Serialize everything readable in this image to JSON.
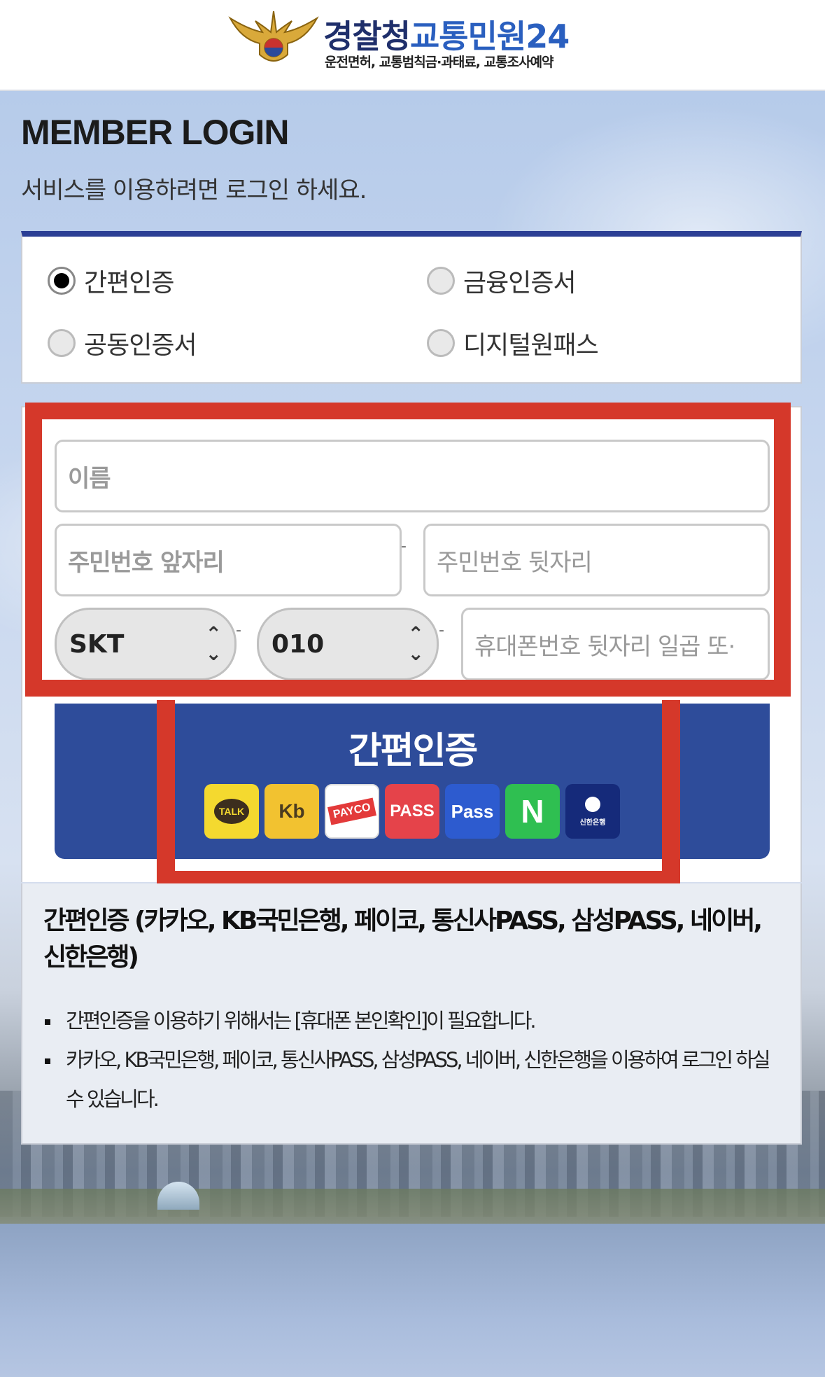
{
  "header": {
    "title_part1": "경찰청",
    "title_part2": "교통민원24",
    "subtitle": "운전면허, 교통범칙금·과태료, 교통조사예약"
  },
  "login": {
    "title": "MEMBER LOGIN",
    "subtitle": "서비스를 이용하려면 로그인 하세요."
  },
  "auth_options": [
    {
      "label": "간편인증",
      "selected": true
    },
    {
      "label": "금융인증서",
      "selected": false
    },
    {
      "label": "공동인증서",
      "selected": false
    },
    {
      "label": "디지털원패스",
      "selected": false
    }
  ],
  "form": {
    "name_placeholder": "이름",
    "rrn_front_placeholder": "주민번호 앞자리",
    "rrn_back_placeholder": "주민번호 뒷자리",
    "carrier_value": "SKT",
    "phone_prefix_value": "010",
    "phone_rest_placeholder": "휴대폰번호 뒷자리 일곱 또·",
    "separator": "-"
  },
  "auth_button": {
    "label": "간편인증",
    "providers": [
      {
        "name": "kakao-icon",
        "text": "TALK"
      },
      {
        "name": "kb-icon",
        "text": "Kb"
      },
      {
        "name": "payco-icon",
        "text": "PAYCO"
      },
      {
        "name": "pass-icon",
        "text": "PASS"
      },
      {
        "name": "samsung-pass-icon",
        "text": "Pass"
      },
      {
        "name": "naver-icon",
        "text": "N"
      },
      {
        "name": "shinhan-icon",
        "text": "신한은행"
      }
    ]
  },
  "description": {
    "title": "간편인증 (카카오, KB국민은행, 페이코, 통신사PASS, 삼성PASS, 네이버, 신한은행)",
    "items": [
      "간편인증을 이용하기 위해서는 [휴대폰 본인확인]이 필요합니다.",
      "카카오, KB국민은행, 페이코, 통신사PASS, 삼성PASS, 네이버, 신한은행을 이용하여 로그인 하실 수 있습니다."
    ]
  },
  "colors": {
    "brand_navy": "#2c3f95",
    "button_blue": "#2e4c9a",
    "highlight_red": "#d5382a"
  }
}
